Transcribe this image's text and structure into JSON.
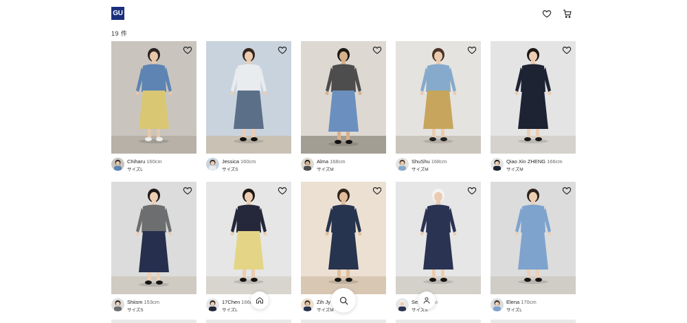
{
  "header": {
    "logo_text": "GU",
    "favorites_icon": "heart-icon",
    "cart_icon": "cart-icon"
  },
  "result_count": "19 件",
  "colors": {
    "brand": "#1b2f7d",
    "text": "#222222"
  },
  "cards": [
    {
      "name": "Chiharu",
      "height": "160cm",
      "size": "サイズL",
      "bg": "#c9c5be",
      "floor": "#b7b1a7",
      "top": "#5d84b3",
      "dress": "#d9c774",
      "skin": "#e7c7a9",
      "hair": "#2b2420",
      "shoe": "#eeeeee"
    },
    {
      "name": "Jessica",
      "height": "160cm",
      "size": "サイズS",
      "bg": "#c9d3de",
      "floor": "#c9c1b4",
      "top": "#e9ecef",
      "dress": "#5c6f89",
      "skin": "#ecccb1",
      "hair": "#33261e",
      "shoe": "#111111"
    },
    {
      "name": "Alma",
      "height": "168cm",
      "size": "サイズM",
      "bg": "#ddd8d1",
      "floor": "#a39e94",
      "top": "#4d4d4d",
      "dress": "#6b8fbf",
      "skin": "#d7b08c",
      "hair": "#1d1915",
      "shoe": "#111111"
    },
    {
      "name": "ShuShu",
      "height": "168cm",
      "size": "サイズM",
      "bg": "#e5e3df",
      "floor": "#cbc6bd",
      "top": "#86aacb",
      "dress": "#c7a55d",
      "skin": "#ebcbaf",
      "hair": "#4a3526",
      "shoe": "#222222"
    },
    {
      "name": "Qiao Xin ZHENG",
      "height": "166cm",
      "size": "サイズM",
      "bg": "#e4e4e4",
      "floor": "#d5d2cd",
      "top": "#1d2333",
      "dress": "#1d2333",
      "skin": "#ecccb2",
      "hair": "#1c1816",
      "shoe": "#1a1a1a"
    },
    {
      "name": "Shiism",
      "height": "153cm",
      "size": "サイズS",
      "bg": "#dcdcdc",
      "floor": "#cfcac2",
      "top": "#6d6e70",
      "dress": "#262f4d",
      "skin": "#eccfb5",
      "hair": "#1f1b19",
      "shoe": "#151515"
    },
    {
      "name": "17Chen",
      "height": "166cm",
      "size": "サイズL",
      "bg": "#e6e6e6",
      "floor": "#d8d4ce",
      "top": "#25283a",
      "dress": "#e4d586",
      "skin": "#ecccb1",
      "hair": "#1d1916",
      "shoe": "#151515"
    },
    {
      "name": "Zih Jy",
      "height": "166cm",
      "size": "サイズM",
      "bg": "#ece0d2",
      "floor": "#d8c7b3",
      "top": "#27344f",
      "dress": "#27344f",
      "skin": "#e1bd9c",
      "hair": "#2f241b",
      "shoe": "#151515"
    },
    {
      "name": "Sen",
      "height": "166cm",
      "size": "サイズS",
      "bg": "#e6e6e6",
      "floor": "#d4d0ca",
      "top": "#2a3352",
      "dress": "#2a3352",
      "skin": "#ecccb1",
      "hair": "#f3f3f3",
      "shoe": "#151515"
    },
    {
      "name": "Elena",
      "height": "170cm",
      "size": "サイズL",
      "bg": "#dcdcdc",
      "floor": "#d0ccc6",
      "top": "#7ea3cd",
      "dress": "#7ea3cd",
      "skin": "#eccfb5",
      "hair": "#2e241d",
      "shoe": "#151515"
    }
  ],
  "bottom_nav": {
    "home_icon": "home-icon",
    "search_icon": "search-icon",
    "user_icon": "user-icon"
  }
}
